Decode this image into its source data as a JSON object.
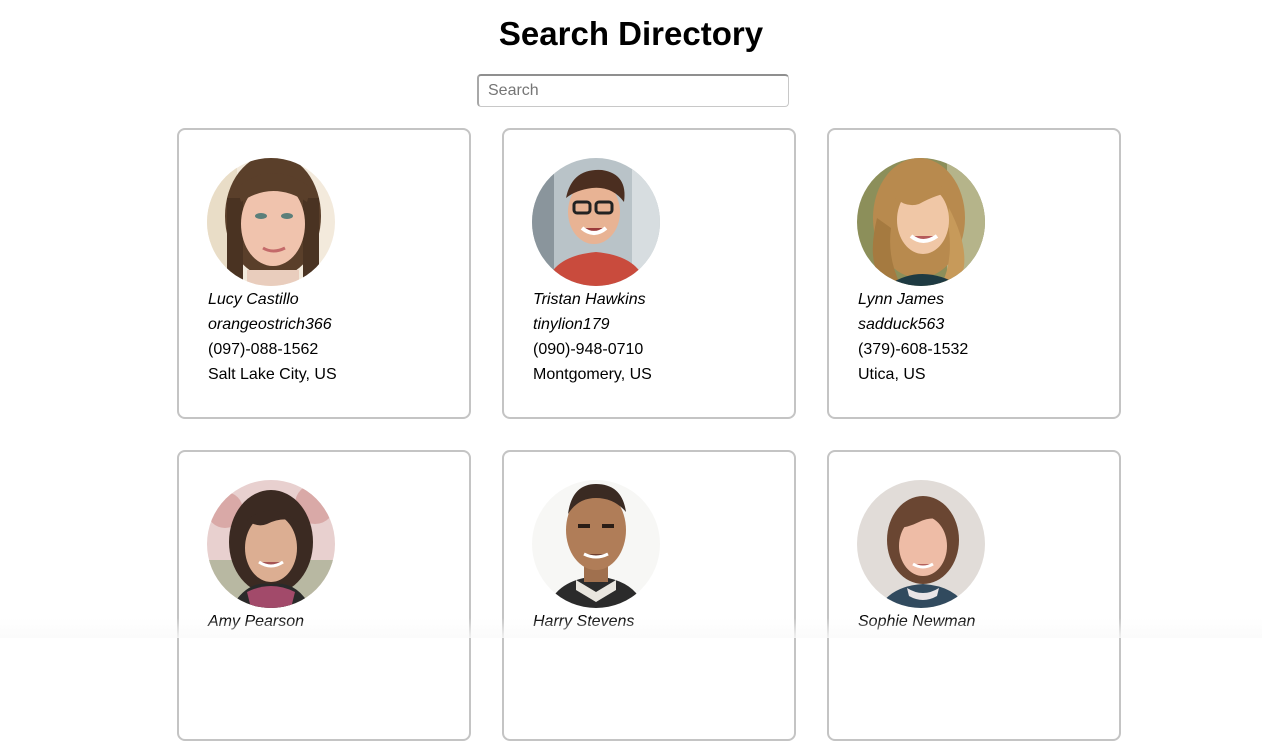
{
  "page": {
    "title": "Search Directory"
  },
  "search": {
    "placeholder": "Search",
    "value": ""
  },
  "employees": [
    {
      "name": "Lucy Castillo",
      "username": "orangeostrich366",
      "phone": "(097)-088-1562",
      "location": "Salt Lake City, US"
    },
    {
      "name": "Tristan Hawkins",
      "username": "tinylion179",
      "phone": "(090)-948-0710",
      "location": "Montgomery, US"
    },
    {
      "name": "Lynn James",
      "username": "sadduck563",
      "phone": "(379)-608-1532",
      "location": "Utica, US"
    },
    {
      "name": "Amy Pearson",
      "username": "",
      "phone": "",
      "location": ""
    },
    {
      "name": "Harry Stevens",
      "username": "",
      "phone": "",
      "location": ""
    },
    {
      "name": "Sophie Newman",
      "username": "",
      "phone": "",
      "location": ""
    }
  ],
  "colors": {
    "card_border": "#c4c4c4",
    "text": "#000000",
    "placeholder": "#757575"
  }
}
